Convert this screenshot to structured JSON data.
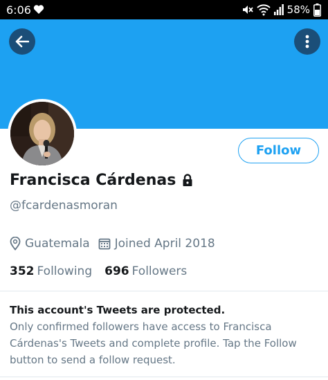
{
  "status_bar": {
    "time": "6:06",
    "battery": "58%",
    "icons": [
      "heart-icon",
      "mute-icon",
      "wifi-icon",
      "signal-icon",
      "battery-icon"
    ]
  },
  "header": {
    "back_icon": "back-arrow-icon",
    "more_icon": "more-vertical-icon",
    "banner_color": "#1da1f2"
  },
  "profile": {
    "name": "Francisca Cárdenas",
    "handle": "@fcardenasmoran",
    "location": "Guatemala",
    "joined": "Joined April 2018",
    "following_count": "352",
    "following_label": "Following",
    "followers_count": "696",
    "followers_label": "Followers",
    "follow_button": "Follow",
    "protected_icon": "lock-icon"
  },
  "protected_notice": {
    "title": "This account's Tweets are protected.",
    "body": "Only confirmed followers have access to Francisca Cárdenas's Tweets and complete profile. Tap the Follow button to send a follow request."
  },
  "colors": {
    "accent": "#1da1f2",
    "header_button": "#1b4e78",
    "secondary_text": "#657786"
  }
}
